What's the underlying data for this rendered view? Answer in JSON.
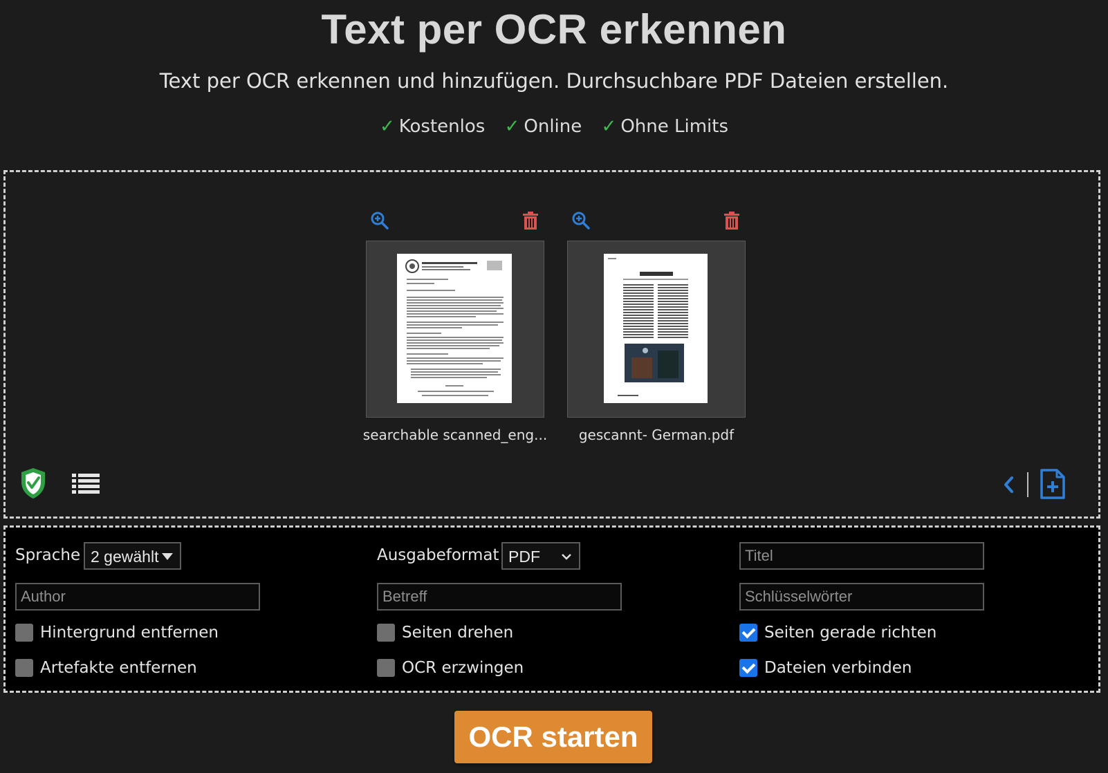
{
  "header": {
    "title": "Text per OCR erkennen",
    "subtitle": "Text per OCR erkennen und hinzufügen. Durchsuchbare PDF Dateien erstellen.",
    "features": [
      "Kostenlos",
      "Online",
      "Ohne Limits"
    ],
    "check_glyph": "✓"
  },
  "files": [
    {
      "name": "searchable scanned_eng...",
      "zoom_icon": "zoom-in-icon",
      "delete_icon": "trash-icon"
    },
    {
      "name": "gescannt- German.pdf",
      "zoom_icon": "zoom-in-icon",
      "delete_icon": "trash-icon"
    }
  ],
  "dropzone_icons": {
    "left": [
      "shield-check-icon",
      "list-icon"
    ],
    "right": [
      "chevron-left-icon",
      "add-file-icon"
    ]
  },
  "options": {
    "language": {
      "label": "Sprache",
      "value": "2 gewählt"
    },
    "output_format": {
      "label": "Ausgabeformat",
      "value": "PDF"
    },
    "title_placeholder": "Titel",
    "author_placeholder": "Author",
    "subject_placeholder": "Betreff",
    "keywords_placeholder": "Schlüsselwörter",
    "checkboxes": [
      {
        "label": "Hintergrund entfernen",
        "checked": false
      },
      {
        "label": "Seiten drehen",
        "checked": false
      },
      {
        "label": "Seiten gerade richten",
        "checked": true
      },
      {
        "label": "Artefakte entfernen",
        "checked": false
      },
      {
        "label": "OCR erzwingen",
        "checked": false
      },
      {
        "label": "Dateien verbinden",
        "checked": true
      }
    ]
  },
  "start_button": "OCR starten",
  "colors": {
    "accent_orange": "#dd8a32",
    "check_green": "#3fb950",
    "checkbox_blue": "#1a73e8",
    "icon_blue": "#2f7fd6",
    "trash_red": "#d9534f"
  }
}
